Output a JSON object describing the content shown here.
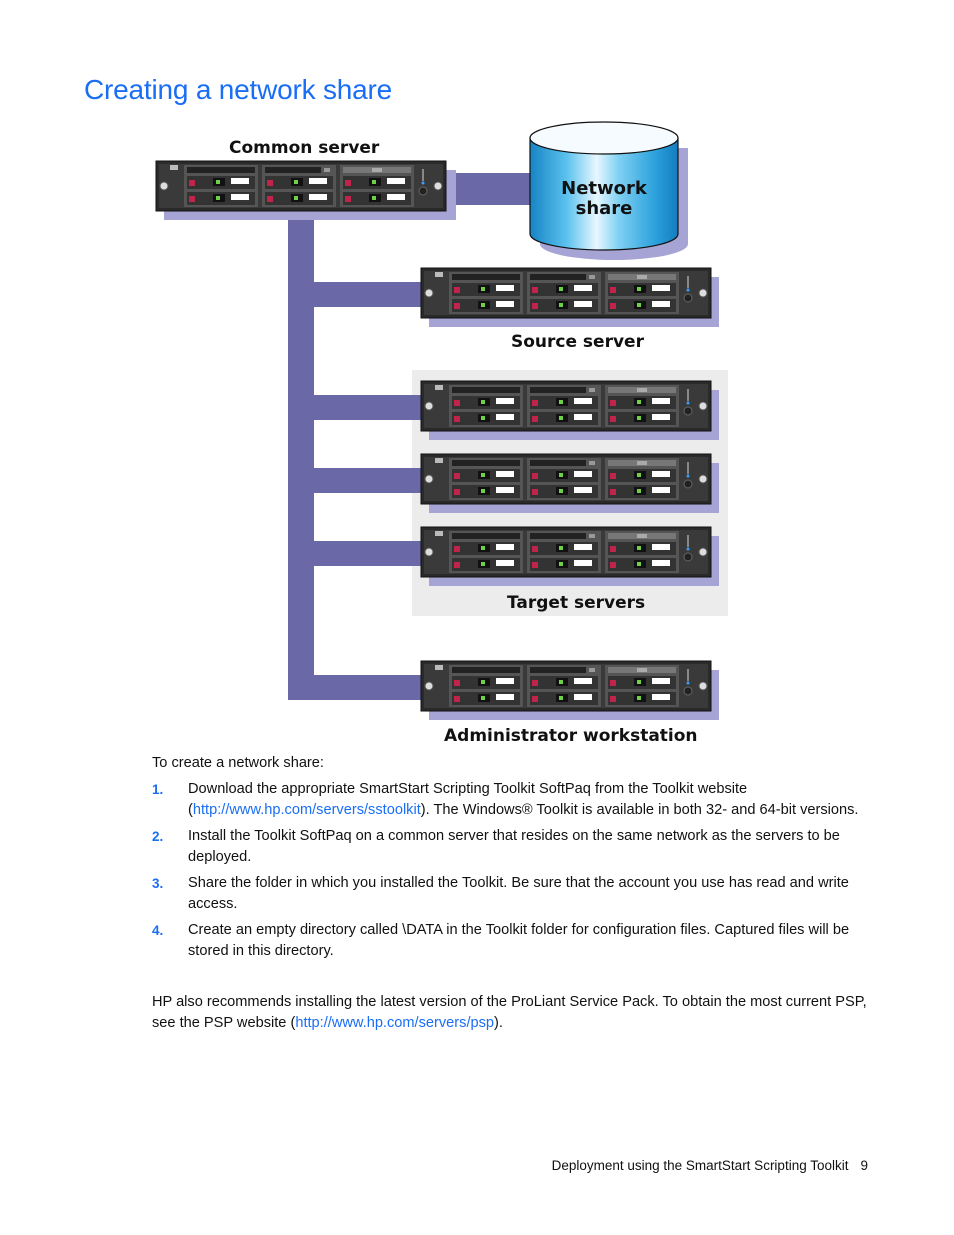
{
  "page": {
    "title": "Creating a network share",
    "colors": {
      "heading": "#1a6ef5",
      "link": "#1a6ef5",
      "connector": "#6a68a6",
      "shadow": "#a6a4d4",
      "cylinder": "#2aa0dc",
      "target_group_bg": "#ececec"
    }
  },
  "diagram": {
    "labels": {
      "common_server": "Common server",
      "network_share_line1": "Network",
      "network_share_line2": "share",
      "source_server": "Source server",
      "target_servers": "Target servers",
      "admin_workstation": "Administrator workstation"
    },
    "nodes": [
      {
        "id": "common-server",
        "type": "server"
      },
      {
        "id": "network-share",
        "type": "storage"
      },
      {
        "id": "source-server",
        "type": "server"
      },
      {
        "id": "target-server-1",
        "type": "server"
      },
      {
        "id": "target-server-2",
        "type": "server"
      },
      {
        "id": "target-server-3",
        "type": "server"
      },
      {
        "id": "admin-workstation",
        "type": "server"
      }
    ]
  },
  "content": {
    "intro": "To create a network share:",
    "steps": [
      {
        "num": "1.",
        "text_before": "Download the appropriate SmartStart Scripting Toolkit SoftPaq from the Toolkit website (",
        "link": "http://www.hp.com/servers/sstoolkit",
        "text_after": "). The Windows® Toolkit is available in both 32- and 64-bit versions."
      },
      {
        "num": "2.",
        "text": "Install the Toolkit SoftPaq on a common server that resides on the same network as the servers to be deployed."
      },
      {
        "num": "3.",
        "text": "Share the folder in which you installed the Toolkit. Be sure that the account you use has read and write access."
      },
      {
        "num": "4.",
        "text": "Create an empty directory called \\DATA in the Toolkit folder for configuration files. Captured files will be stored in this directory."
      }
    ],
    "note": {
      "text_before": "HP also recommends installing the latest version of the ProLiant Service Pack. To obtain the most current PSP, see the PSP website (",
      "link": "http://www.hp.com/servers/psp",
      "text_after": ")."
    }
  },
  "footer": {
    "section": "Deployment using the SmartStart Scripting Toolkit",
    "page_number": "9"
  }
}
